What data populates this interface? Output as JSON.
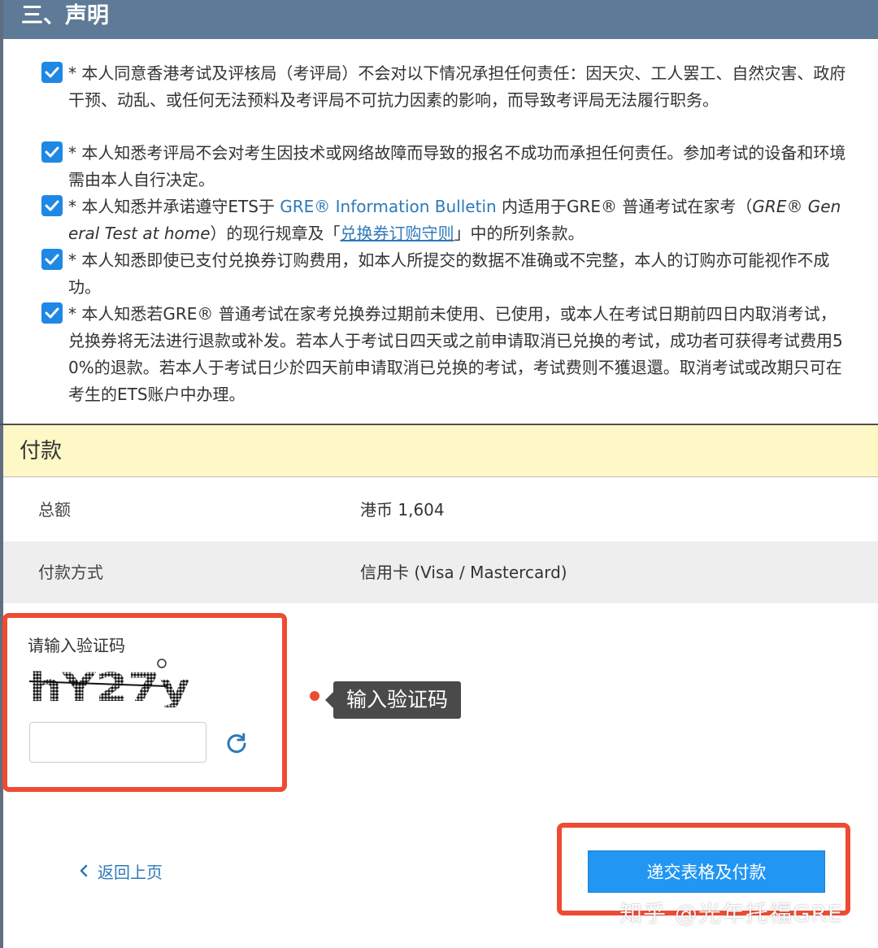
{
  "colors": {
    "header_bg": "#5e7a96",
    "checkbox": "#1e88e5",
    "link": "#2d7ab8",
    "payment_header_bg": "#fdf8c6",
    "alt_row_bg": "#eeeeee",
    "highlight": "#ee4b33",
    "tooltip_bg": "#4a4a4a",
    "submit_bg": "#2196f3"
  },
  "section": {
    "title": "三、声明"
  },
  "declarations": [
    {
      "checked": true,
      "text": "* 本人同意香港考试及评核局（考评局）不会对以下情况承担任何责任：因天灾、工人罢工、自然灾害、政府干预、动乱、或任何无法预料及考评局不可抗力因素的影响，而导致考评局无法履行职务。"
    },
    {
      "checked": true,
      "text": "* 本人知悉考评局不会对考生因技术或网络故障而导致的报名不成功而承担任何责任。参加考试的设备和环境需由本人自行决定。"
    },
    {
      "checked": true,
      "part1": "* 本人知悉并承诺遵守ETS于 ",
      "link1": "GRE® Information Bulletin",
      "part2": " 内适用于GRE® 普通考试在家考（",
      "italic": "GRE® General Test at home",
      "part3": "）的现行规章及「",
      "link2": "兑换券订购守则",
      "part4": "」中的所列条款。"
    },
    {
      "checked": true,
      "text": "* 本人知悉即使已支付兑换券订购费用，如本人所提交的数据不准确或不完整，本人的订购亦可能视作不成功。"
    },
    {
      "checked": true,
      "text": "* 本人知悉若GRE® 普通考试在家考兑换券过期前未使用、已使用，或本人在考试日期前四日内取消考试，兑换券将无法进行退款或补发。若本人于考试日四天或之前申请取消已兑换的考试，成功者可获得考试费用50%的退款。若本人于考试日少於四天前申请取消已兑换的考试，考试费则不獲退還。取消考试或改期只可在考生的ETS账户中办理。"
    }
  ],
  "payment": {
    "title": "付款",
    "total_label": "总额",
    "total_value": "港币 1,604",
    "method_label": "付款方式",
    "method_value": "信用卡 (Visa / Mastercard)"
  },
  "captcha": {
    "label": "请输入验证码",
    "code": "hY27y",
    "input_value": "",
    "refresh_icon": "refresh-icon"
  },
  "annotation": {
    "tooltip": "输入验证码"
  },
  "nav": {
    "back_label": "返回上页",
    "back_icon": "chevron-left-icon",
    "submit_label": "递交表格及付款"
  },
  "watermark": "知乎 @光年托福GRE"
}
